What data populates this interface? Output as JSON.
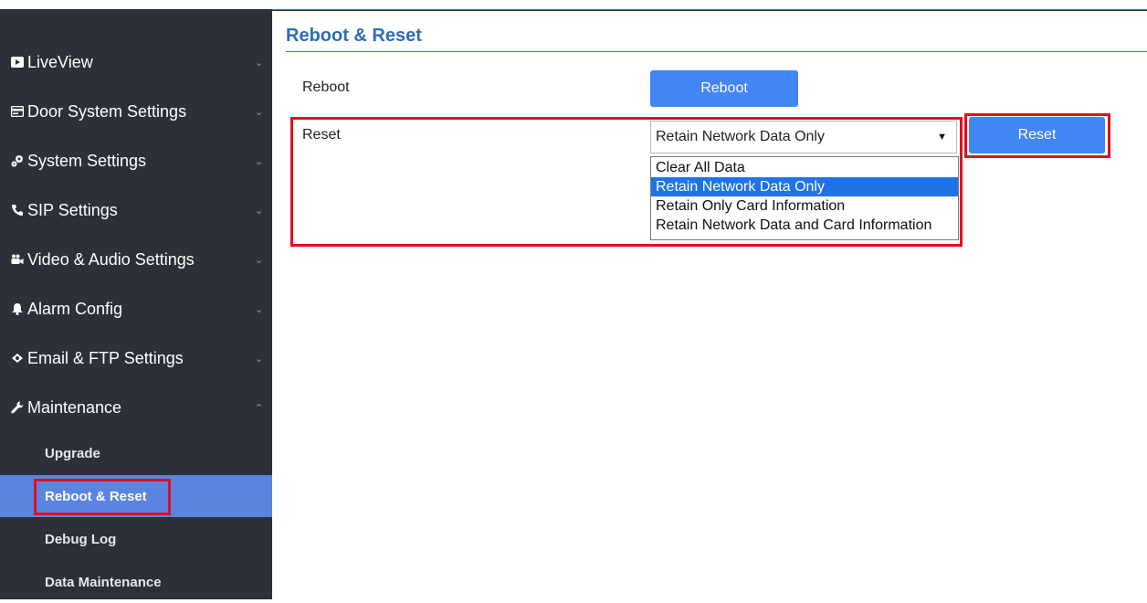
{
  "sidebar": {
    "items": [
      {
        "label": "LiveView",
        "icon": "play-square-icon",
        "chevron": "⌄"
      },
      {
        "label": "Door System Settings",
        "icon": "card-icon",
        "chevron": "⌄"
      },
      {
        "label": "System Settings",
        "icon": "gears-icon",
        "chevron": "⌄"
      },
      {
        "label": "SIP Settings",
        "icon": "phone-icon",
        "chevron": "⌄"
      },
      {
        "label": "Video & Audio Settings",
        "icon": "video-camera-icon",
        "chevron": "⌄"
      },
      {
        "label": "Alarm Config",
        "icon": "bell-icon",
        "chevron": "⌄"
      },
      {
        "label": "Email & FTP Settings",
        "icon": "cloud-icon",
        "chevron": "⌄"
      },
      {
        "label": "Maintenance",
        "icon": "wrench-icon",
        "chevron": "⌃"
      }
    ],
    "subitems": [
      {
        "label": "Upgrade"
      },
      {
        "label": "Reboot & Reset"
      },
      {
        "label": "Debug Log"
      },
      {
        "label": "Data Maintenance"
      }
    ]
  },
  "main": {
    "title": "Reboot & Reset",
    "reboot_label": "Reboot",
    "reboot_button": "Reboot",
    "reset_label": "Reset",
    "reset_button": "Reset",
    "reset_select": {
      "value": "Retain Network Data Only",
      "options": [
        "Clear All Data",
        "Retain Network Data Only",
        "Retain Only Card Information",
        "Retain Network Data and Card Information"
      ]
    }
  },
  "colors": {
    "sidebar_bg": "#2b3039",
    "active_item": "#5a84e0",
    "button": "#4285f4",
    "title": "#2e6db3",
    "highlight": "#e0101f"
  }
}
